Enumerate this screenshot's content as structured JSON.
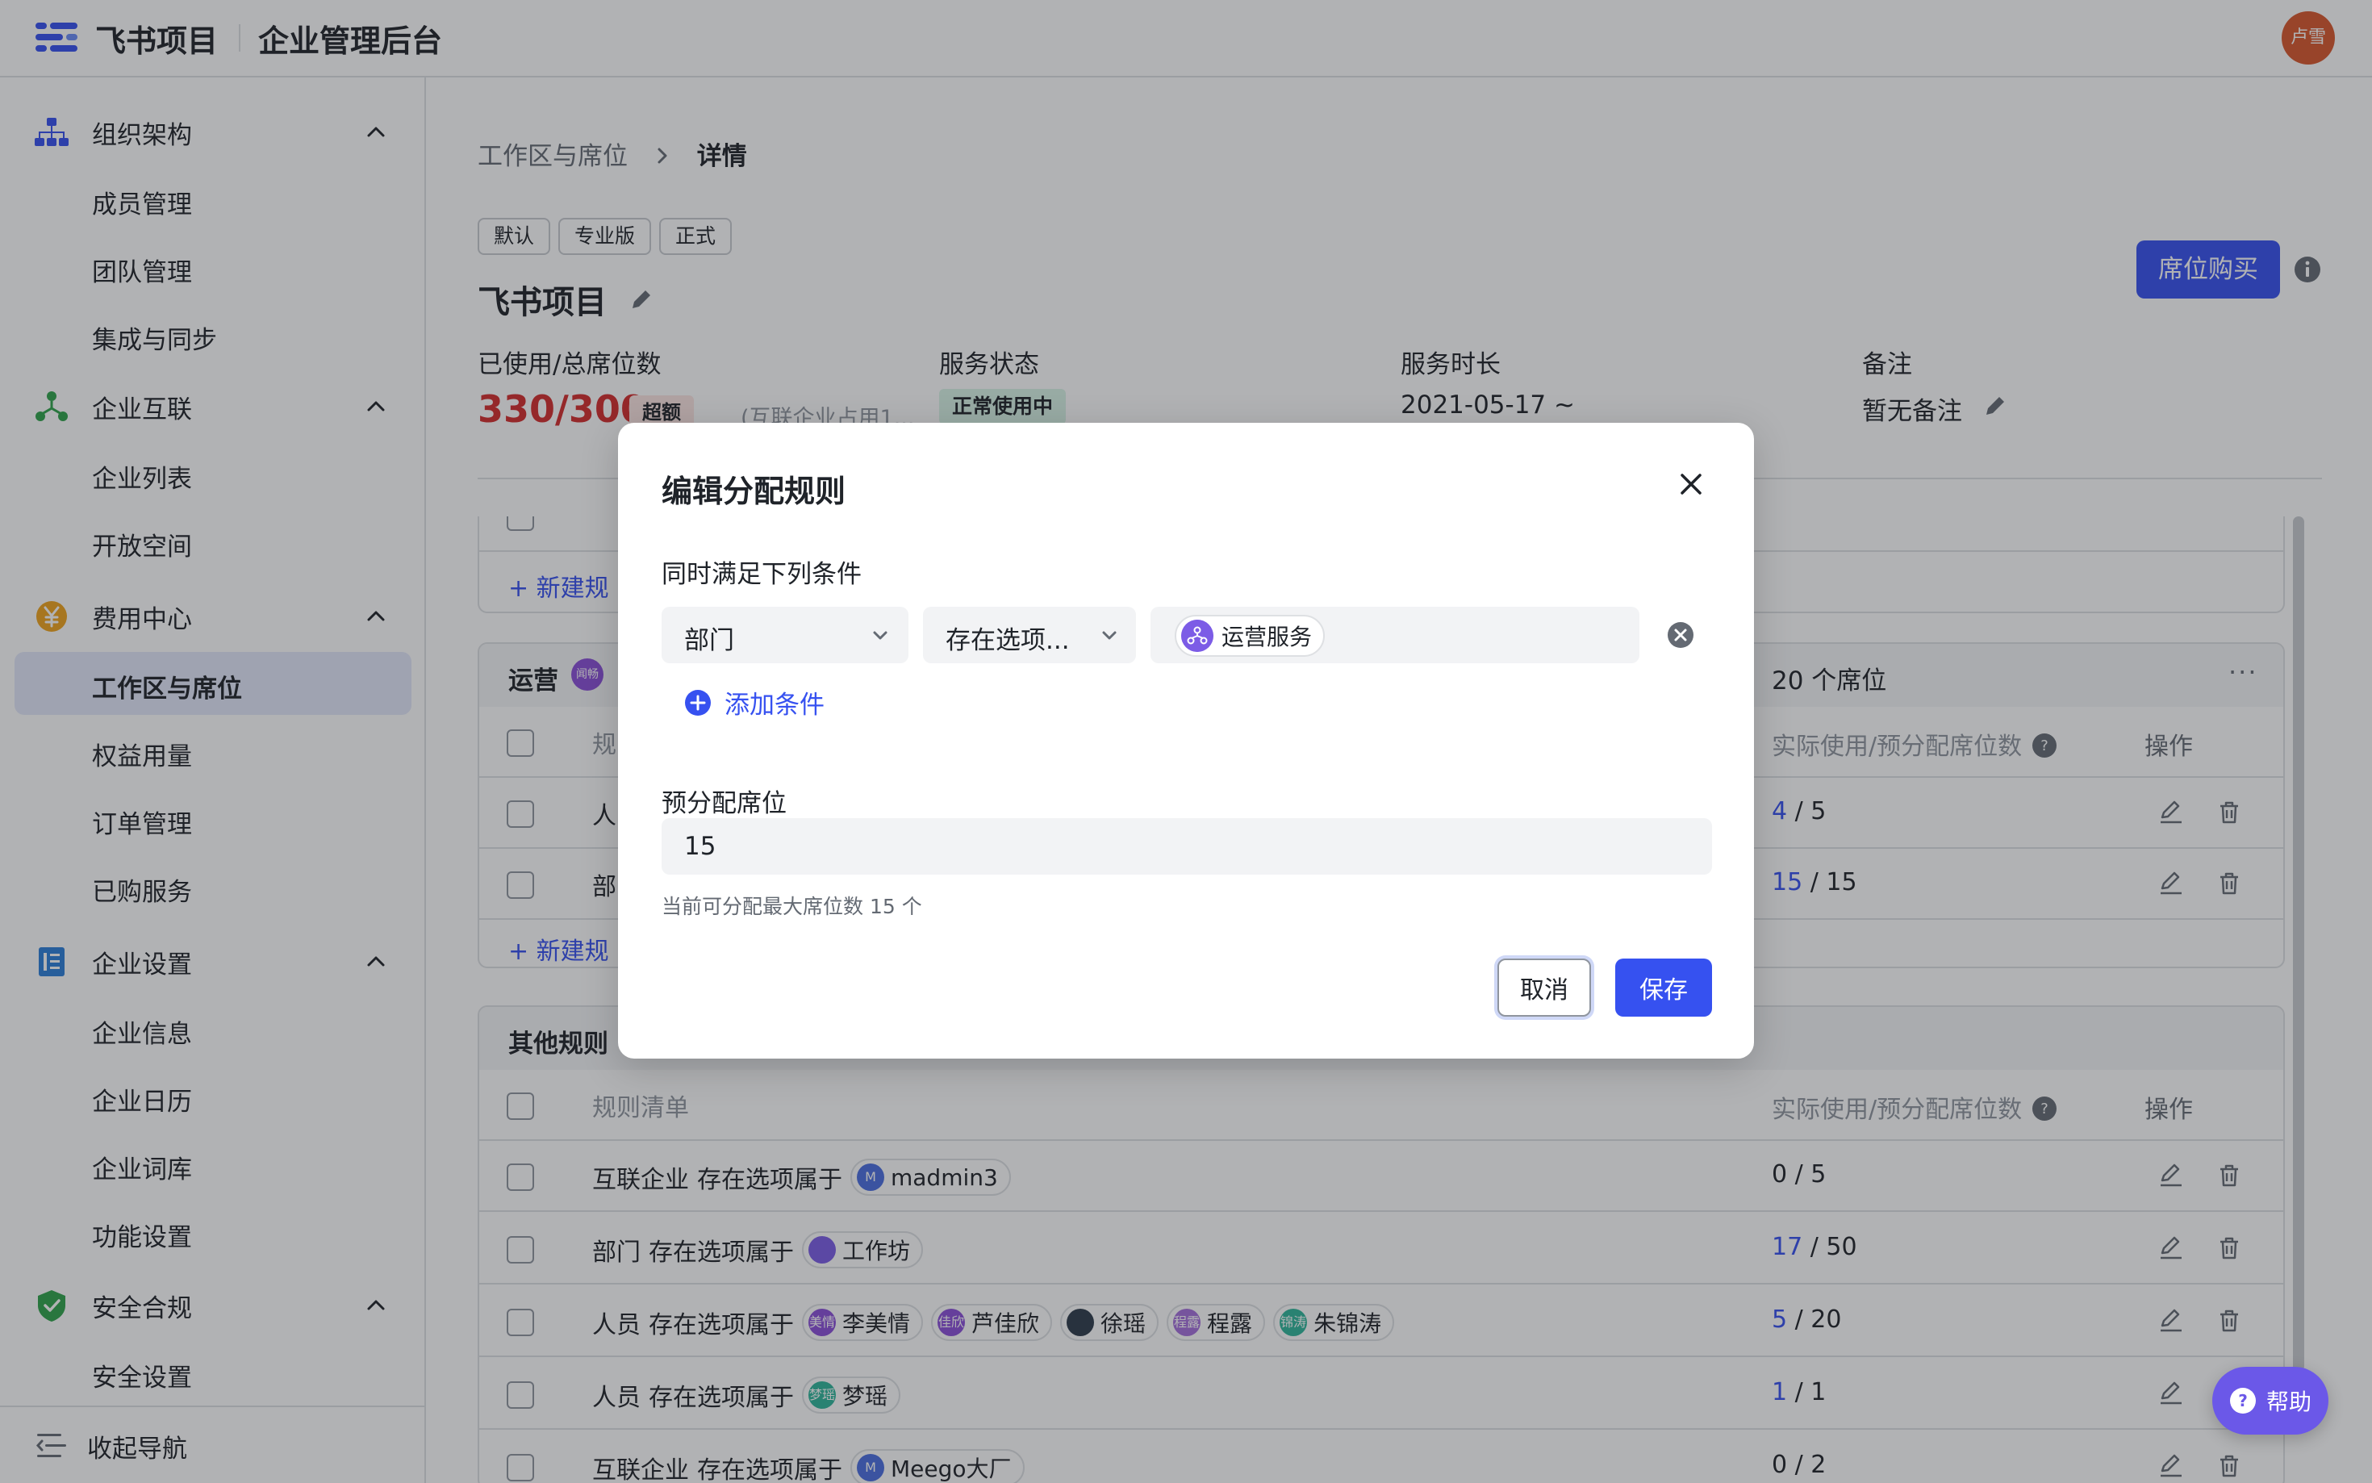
{
  "header": {
    "app_title": "飞书项目",
    "subtitle": "企业管理后台",
    "avatar_text": "卢雪"
  },
  "sidebar": {
    "groups": [
      {
        "label": "组织架构",
        "icon": "org-chart-icon",
        "items": [
          "成员管理",
          "团队管理",
          "集成与同步"
        ]
      },
      {
        "label": "企业互联",
        "icon": "network-icon",
        "items": [
          "企业列表",
          "开放空间"
        ]
      },
      {
        "label": "费用中心",
        "icon": "yuan-coin-icon",
        "items": [
          "工作区与席位",
          "权益用量",
          "订单管理",
          "已购服务"
        ]
      },
      {
        "label": "企业设置",
        "icon": "document-icon",
        "items": [
          "企业信息",
          "企业日历",
          "企业词库",
          "功能设置"
        ]
      },
      {
        "label": "安全合规",
        "icon": "shield-check-icon",
        "items": [
          "安全设置"
        ]
      }
    ],
    "active_item": "工作区与席位",
    "collapse_label": "收起导航"
  },
  "breadcrumb": {
    "parent": "工作区与席位",
    "current": "详情"
  },
  "workspace": {
    "tags": [
      "默认",
      "专业版",
      "正式"
    ],
    "title": "飞书项目",
    "buy_button": "席位购买"
  },
  "stats": {
    "seats_label": "已使用/总席位数",
    "seats_value": "330/300",
    "over_badge": "超额",
    "partner_note": "(互联企业占用1...",
    "status_label": "服务状态",
    "status_value": "正常使用中",
    "duration_label": "服务时长",
    "duration_value": "2021-05-17 ~",
    "remark_label": "备注",
    "remark_value": "暂无备注"
  },
  "cards": {
    "top_new_rule": "+ 新建规",
    "ops_group": {
      "title": "运营",
      "owner_avatar": "闻畅",
      "seats": "20 个席位",
      "head_rule": "规",
      "head_usage": "实际使用/预分配席位数",
      "head_ops": "操作",
      "rows": [
        {
          "rule": "人",
          "used": "4",
          "total": " / 5"
        },
        {
          "rule": "部",
          "used": "15",
          "total": " / 15"
        }
      ],
      "new_rule": "+ 新建规"
    },
    "other_rules": {
      "title": "其他规则",
      "head_rule": "规则清单",
      "head_usage": "实际使用/预分配席位数",
      "head_ops": "操作",
      "rows": [
        {
          "field": "互联企业",
          "op": "存在选项属于",
          "chips": [
            {
              "label": "madmin3",
              "avatar": "M",
              "color": "#4a6ee0"
            }
          ],
          "used": "0",
          "total": " / 5",
          "highlight": false
        },
        {
          "field": "部门",
          "op": "存在选项属于",
          "chips": [
            {
              "label": "工作坊",
              "avatar": "",
              "color": "#7c5ce6"
            }
          ],
          "used": "17",
          "total": " / 50",
          "highlight": true
        },
        {
          "field": "人员",
          "op": "存在选项属于",
          "chips": [
            {
              "label": "李美情",
              "avatar": "美情",
              "color": "#8b4fd9"
            },
            {
              "label": "芦佳欣",
              "avatar": "佳欣",
              "color": "#8b4fd9"
            },
            {
              "label": "徐瑶",
              "avatar": "",
              "color": "#2d3b4a"
            },
            {
              "label": "程露",
              "avatar": "程露",
              "color": "#a56fdc"
            },
            {
              "label": "朱锦涛",
              "avatar": "锦涛",
              "color": "#2fb59a"
            }
          ],
          "used": "5",
          "total": " / 20",
          "highlight": true
        },
        {
          "field": "人员",
          "op": "存在选项属于",
          "chips": [
            {
              "label": "梦瑶",
              "avatar": "梦瑶",
              "color": "#2fb59a"
            }
          ],
          "used": "1",
          "total": " / 1",
          "highlight": true
        },
        {
          "field": "互联企业",
          "op": "存在选项属于",
          "chips": [
            {
              "label": "Meego大厂",
              "avatar": "M",
              "color": "#4a6ee0"
            }
          ],
          "used": "0",
          "total": " / 2",
          "highlight": false
        }
      ]
    }
  },
  "modal": {
    "title": "编辑分配规则",
    "conditions_label": "同时满足下列条件",
    "field_select": "部门",
    "operator_select": "存在选项...",
    "value_chip": "运营服务",
    "add_condition": "添加条件",
    "prealloc_label": "预分配席位",
    "prealloc_value": "15",
    "prealloc_hint": "当前可分配最大席位数 15 个",
    "cancel": "取消",
    "save": "保存"
  },
  "help_button": "帮助",
  "colors": {
    "primary": "#3651f0",
    "danger": "#d42b2b",
    "active_nav_bg": "#e3e8fa",
    "help": "#6b58e8"
  }
}
